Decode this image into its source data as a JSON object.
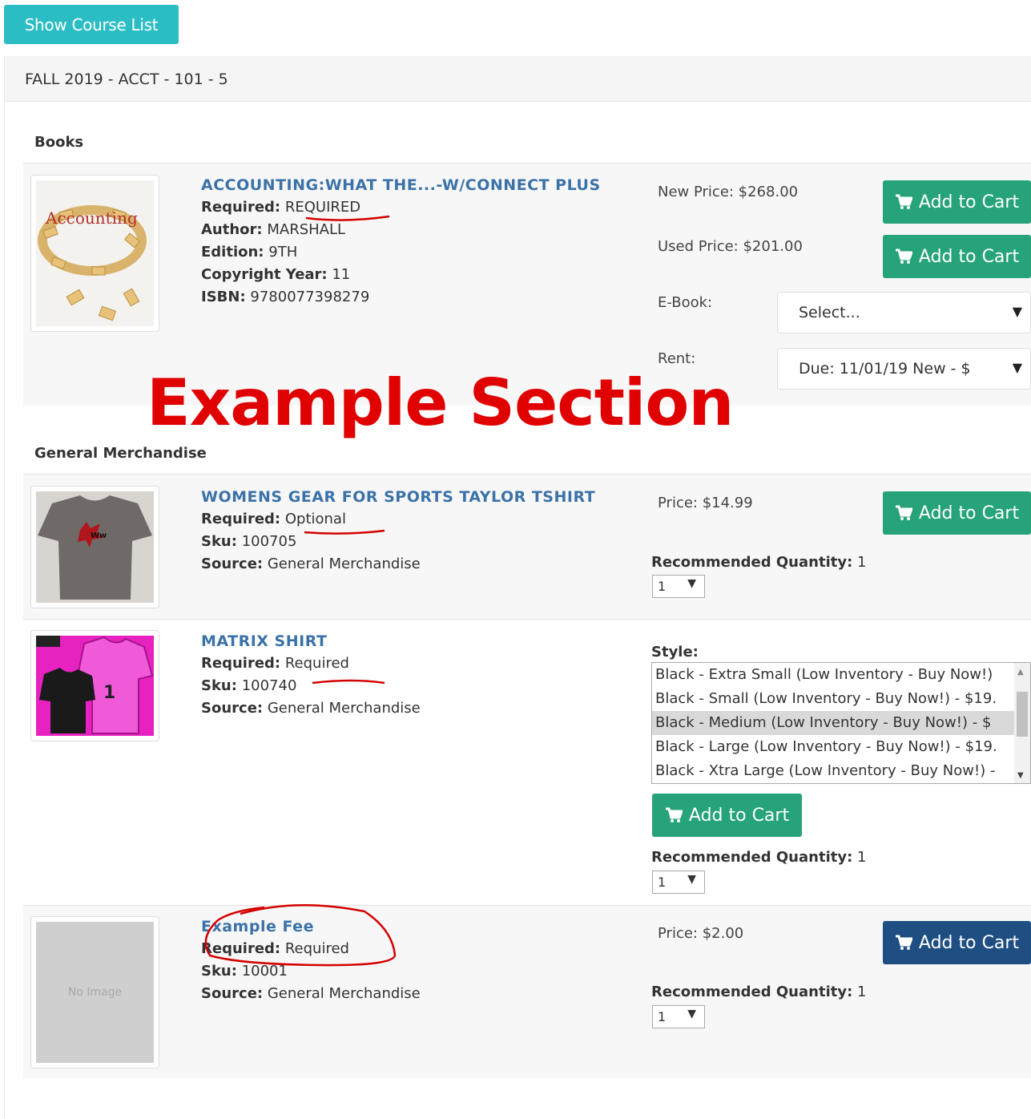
{
  "header": {
    "show_course_list": "Show Course List"
  },
  "course": {
    "title": "FALL 2019 - ACCT - 101 - 5"
  },
  "sections": {
    "books": "Books",
    "merch": "General Merchandise"
  },
  "annotation": {
    "text": "Example Section"
  },
  "book": {
    "cover_text": "Accounting",
    "title": "ACCOUNTING:WHAT THE...-W/CONNECT PLUS",
    "required_label": "Required:",
    "required_value": "REQUIRED",
    "author_label": "Author:",
    "author_value": "MARSHALL",
    "edition_label": "Edition:",
    "edition_value": "9TH",
    "copyright_label": "Copyright Year:",
    "copyright_value": "11",
    "isbn_label": "ISBN:",
    "isbn_value": "9780077398279",
    "new_price": "New Price: $268.00",
    "used_price": "Used Price: $201.00",
    "ebook_label": "E-Book:",
    "ebook_select": "Select...",
    "rent_label": "Rent:",
    "rent_select": "Due: 11/01/19 New - $"
  },
  "tshirt": {
    "title": "WOMENS GEAR FOR SPORTS TAYLOR TSHIRT",
    "required_label": "Required:",
    "required_value": "Optional",
    "sku_label": "Sku:",
    "sku_value": "100705",
    "source_label": "Source:",
    "source_value": "General Merchandise",
    "price": "Price: $14.99",
    "qty_label": "Recommended Quantity:",
    "qty_value": "1",
    "qty_select": "1"
  },
  "matrix": {
    "title": "MATRIX SHIRT",
    "required_label": "Required:",
    "required_value": "Required",
    "sku_label": "Sku:",
    "sku_value": "100740",
    "source_label": "Source:",
    "source_value": "General Merchandise",
    "style_label": "Style:",
    "style_options": [
      "Black - Extra Small (Low Inventory - Buy Now!)",
      "Black - Small (Low Inventory - Buy Now!) - $19.",
      "Black - Medium (Low Inventory - Buy Now!) - $",
      "Black - Large (Low Inventory - Buy Now!) - $19.",
      "Black - Xtra Large (Low Inventory - Buy Now!) -"
    ],
    "qty_label": "Recommended Quantity:",
    "qty_value": "1",
    "qty_select": "1"
  },
  "fee": {
    "no_image": "No Image",
    "title": "Example Fee",
    "required_label": "Required:",
    "required_value": "Required",
    "sku_label": "Sku:",
    "sku_value": "10001",
    "source_label": "Source:",
    "source_value": "General Merchandise",
    "price": "Price: $2.00",
    "qty_label": "Recommended Quantity:",
    "qty_value": "1",
    "qty_select": "1"
  },
  "buttons": {
    "add_to_cart": "Add to Cart"
  },
  "colors": {
    "teal": "#2bbdc4",
    "green": "#26a37a",
    "navy": "#1f4e82",
    "link": "#3b72a8",
    "annotation_red": "#e10000"
  },
  "icons": {
    "cart": "cart-icon",
    "dropdown": "chevron-down-icon"
  }
}
